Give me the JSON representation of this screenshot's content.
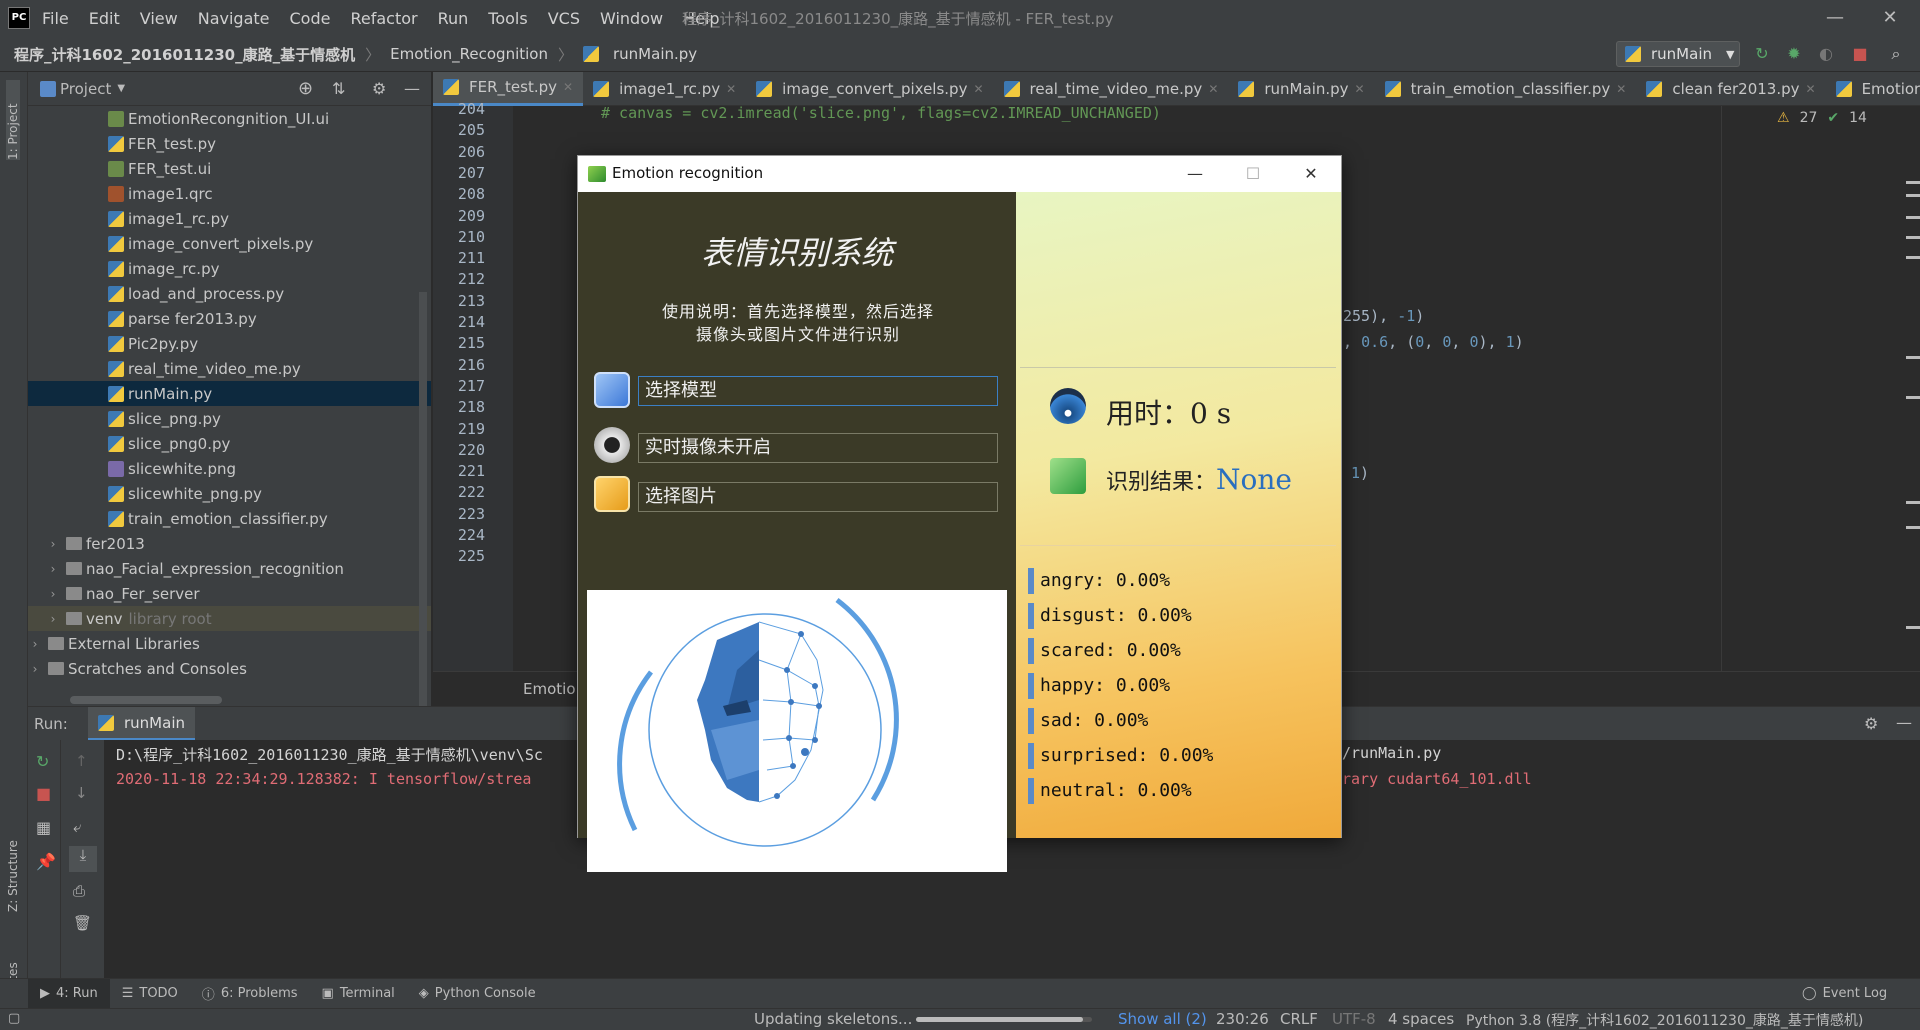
{
  "menu": [
    "File",
    "Edit",
    "View",
    "Navigate",
    "Code",
    "Refactor",
    "Run",
    "Tools",
    "VCS",
    "Window",
    "Help"
  ],
  "window_title": "程序_计科1602_2016011230_康路_基于情感机 - FER_test.py",
  "breadcrumb": [
    "程序_计科1602_2016011230_康路_基于情感机",
    "Emotion_Recognition",
    "runMain.py"
  ],
  "run_config": "runMain",
  "project": {
    "header": "Project",
    "items": [
      {
        "name": "EmotionRecongnition_UI.ui",
        "type": "ui",
        "level": 2
      },
      {
        "name": "FER_test.py",
        "type": "py",
        "level": 2
      },
      {
        "name": "FER_test.ui",
        "type": "ui",
        "level": 2
      },
      {
        "name": "image1.qrc",
        "type": "qrc",
        "level": 2
      },
      {
        "name": "image1_rc.py",
        "type": "py",
        "level": 2
      },
      {
        "name": "image_convert_pixels.py",
        "type": "py",
        "level": 2
      },
      {
        "name": "image_rc.py",
        "type": "py",
        "level": 2
      },
      {
        "name": "load_and_process.py",
        "type": "py",
        "level": 2
      },
      {
        "name": "parse fer2013.py",
        "type": "py",
        "level": 2
      },
      {
        "name": "Pic2py.py",
        "type": "py",
        "level": 2
      },
      {
        "name": "real_time_video_me.py",
        "type": "py",
        "level": 2
      },
      {
        "name": "runMain.py",
        "type": "py",
        "level": 2,
        "selected": true
      },
      {
        "name": "slice_png.py",
        "type": "py",
        "level": 2
      },
      {
        "name": "slice_png0.py",
        "type": "py",
        "level": 2
      },
      {
        "name": "slicewhite.png",
        "type": "png",
        "level": 2
      },
      {
        "name": "slicewhite_png.py",
        "type": "py",
        "level": 2
      },
      {
        "name": "train_emotion_classifier.py",
        "type": "py",
        "level": 2
      },
      {
        "name": "fer2013",
        "type": "folder",
        "level": 1
      },
      {
        "name": "nao_Facial_expression_recognition",
        "type": "folder",
        "level": 1
      },
      {
        "name": "nao_Fer_server",
        "type": "folder",
        "level": 1
      },
      {
        "name": "venv",
        "type": "folder",
        "level": 1,
        "suffix": "library root"
      },
      {
        "name": "External Libraries",
        "type": "lib",
        "level": 0
      },
      {
        "name": "Scratches and Consoles",
        "type": "scratch",
        "level": 0
      }
    ]
  },
  "tabs": [
    "FER_test.py",
    "image1_rc.py",
    "image_convert_pixels.py",
    "real_time_video_me.py",
    "runMain.py",
    "train_emotion_classifier.py",
    "clean fer2013.py",
    "Emotior"
  ],
  "line_numbers": [
    "204",
    "205",
    "206",
    "207",
    "208",
    "209",
    "210",
    "211",
    "212",
    "213",
    "214",
    "215",
    "216",
    "217",
    "218",
    "219",
    "220",
    "221",
    "222",
    "223",
    "224",
    "225"
  ],
  "code_fragments": {
    "line204": "# canvas = cv2.imread('slice.png', flags=cv2.IMREAD_UNCHANGED)",
    "line212_a": "255), ",
    "line212_b": "-1",
    "line212_c": ")",
    "line213_a": ", ",
    "line213_b": "0.6",
    "line213_c": ", (",
    "line213_d": "0",
    "line213_e": ", ",
    "line213_f": "0",
    "line213_g": ", ",
    "line213_h": "0",
    "line213_i": "), ",
    "line213_j": "1",
    "line213_k": ")",
    "line218_a": "1",
    "line218_b": ")"
  },
  "inspections": {
    "warnings": "27",
    "ok": "14"
  },
  "editor_breadcrumb": "Emotio",
  "run": {
    "label": "Run:",
    "tab": "runMain",
    "console": [
      "D:\\程序_计科1602_2016011230_康路_基于情感机\\venv\\Sc",
      "2020-11-18 22:34:29.128382: I tensorflow/strea"
    ],
    "console_right": [
      "/runMain.py",
      "rary cudart64_101.dll"
    ]
  },
  "left_strip": {
    "project": "1: Project",
    "structure": "Z: Structure",
    "favorites": "2: Favorites"
  },
  "bottom_tools": [
    "4: Run",
    "TODO",
    "6: Problems",
    "Terminal",
    "Python Console"
  ],
  "event_log": "Event Log",
  "status": {
    "task": "Updating skeletons...",
    "show_all": "Show all (2)",
    "position": "230:26",
    "line_sep": "CRLF",
    "encoding": "UTF-8",
    "indent": "4 spaces",
    "interpreter": "Python 3.8 (程序_计科1602_2016011230_康路_基于情感机)"
  },
  "dialog": {
    "title": "Emotion recognition",
    "system_title": "表情识别系统",
    "instructions_1": "使用说明：首先选择模型，然后选择",
    "instructions_2": "摄像头或图片文件进行识别",
    "select_model": "选择模型",
    "camera": "实时摄像未开启",
    "select_image": "选择图片",
    "time_label": "用时：0 s",
    "result_label": "识别结果：",
    "result_value": "None",
    "emotions": [
      "angry: 0.00%",
      "disgust: 0.00%",
      "scared: 0.00%",
      "happy: 0.00%",
      "sad: 0.00%",
      "surprised: 0.00%",
      "neutral: 0.00%"
    ]
  },
  "colors": {
    "accent": "#4a88c7",
    "dialog_left": "#3b3a27",
    "result": "#2a6fbf"
  }
}
